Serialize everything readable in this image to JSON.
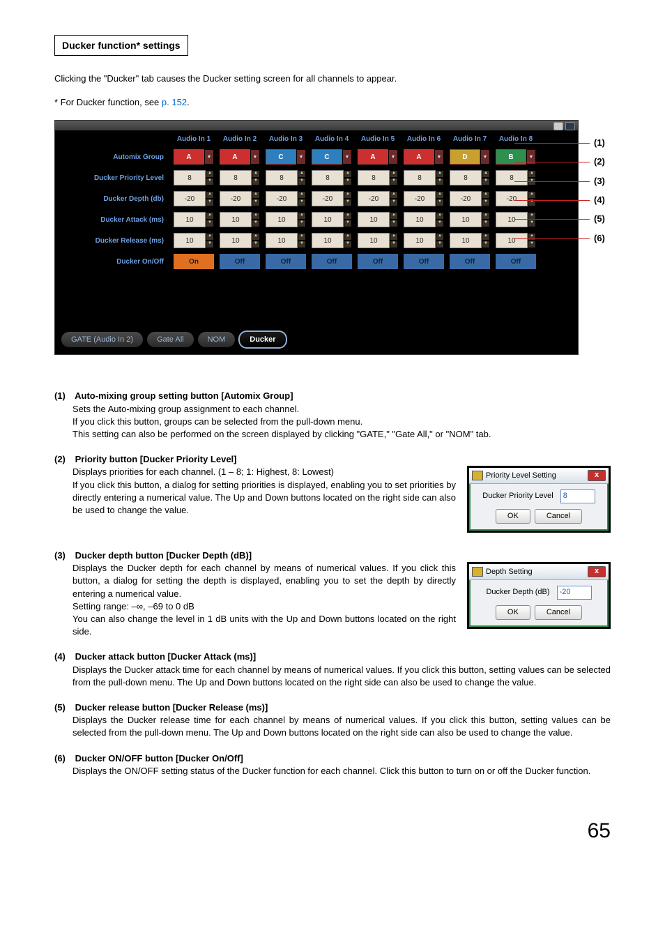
{
  "page_number": "65",
  "heading": "Ducker function* settings",
  "paragraphs": {
    "intro1": "Clicking the \"Ducker\" tab causes the Ducker setting screen for all channels to appear.",
    "intro2_pre": "* For Ducker function, see ",
    "intro2_link": "p. 152",
    "intro2_post": "."
  },
  "panel": {
    "row_labels": [
      "Automix Group",
      "Ducker Priority Level",
      "Ducker Depth (db)",
      "Ducker Attack (ms)",
      "Ducker Release (ms)",
      "Ducker On/Off"
    ],
    "channel_headers": [
      "Audio In 1",
      "Audio In 2",
      "Audio In 3",
      "Audio In 4",
      "Audio In 5",
      "Audio In 6",
      "Audio In 7",
      "Audio In 8"
    ],
    "automix_group": [
      "A",
      "A",
      "C",
      "C",
      "A",
      "A",
      "D",
      "B"
    ],
    "priority": [
      "8",
      "8",
      "8",
      "8",
      "8",
      "8",
      "8",
      "8"
    ],
    "depth": [
      "-20",
      "-20",
      "-20",
      "-20",
      "-20",
      "-20",
      "-20",
      "-20"
    ],
    "attack": [
      "10",
      "10",
      "10",
      "10",
      "10",
      "10",
      "10",
      "10"
    ],
    "release": [
      "10",
      "10",
      "10",
      "10",
      "10",
      "10",
      "10",
      "10"
    ],
    "onoff": [
      "On",
      "Off",
      "Off",
      "Off",
      "Off",
      "Off",
      "Off",
      "Off"
    ],
    "tabs": [
      "GATE (Audio In 2)",
      "Gate All",
      "NOM",
      "Ducker"
    ],
    "active_tab_index": 3
  },
  "callout_numbers": [
    "(1)",
    "(2)",
    "(3)",
    "(4)",
    "(5)",
    "(6)"
  ],
  "items": [
    {
      "num": "(1)",
      "title": " Auto-mixing group setting button [Automix Group]",
      "body": "Sets the Auto-mixing group assignment to each channel.\nIf you click this button, groups can be selected from the pull-down menu.\nThis setting can also be performed on the screen displayed by clicking \"GATE,\" \"Gate All,\" or \"NOM\" tab."
    },
    {
      "num": "(2)",
      "title": " Priority button [Ducker Priority Level]",
      "body": "Displays priorities for each channel. (1 – 8; 1: Highest, 8: Lowest)\nIf you click this button, a dialog for setting priorities is displayed, enabling you to set priorities by directly entering a numerical value. The Up and Down buttons located on the right side can also be used to change the value."
    },
    {
      "num": "(3)",
      "title": " Ducker depth button [Ducker Depth (dB)]",
      "body": "Displays the Ducker depth for each channel by means of numerical values. If you click this button, a dialog for setting the depth is displayed, enabling you to set the depth by directly entering a numerical value.\nSetting range: –∞, –69 to 0 dB\nYou can also change the level in 1 dB units with the Up and Down buttons located on the right side."
    },
    {
      "num": "(4)",
      "title": " Ducker attack button [Ducker Attack (ms)]",
      "body": "Displays the Ducker attack time for each channel by means of numerical values. If you click this button, setting values can be selected from the pull-down menu. The Up and Down buttons located on the right side can also be used to change the value."
    },
    {
      "num": "(5)",
      "title": " Ducker release button [Ducker Release (ms)]",
      "body": "Displays the Ducker release time for each channel by means of numerical values. If you click this button, setting values can be selected from the pull-down menu. The Up and Down buttons located on the right side can also be used to change the value."
    },
    {
      "num": "(6)",
      "title": " Ducker ON/OFF button [Ducker On/Off]",
      "body": "Displays the ON/OFF setting status of the Ducker function for each channel. Click this button to turn on or off the Ducker function."
    }
  ],
  "dialogs": {
    "priority": {
      "title": "Priority Level Setting",
      "label": "Ducker Priority Level",
      "value": "8",
      "ok": "OK",
      "cancel": "Cancel"
    },
    "depth": {
      "title": "Depth Setting",
      "label": "Ducker Depth (dB)",
      "value": "-20",
      "ok": "OK",
      "cancel": "Cancel"
    }
  }
}
